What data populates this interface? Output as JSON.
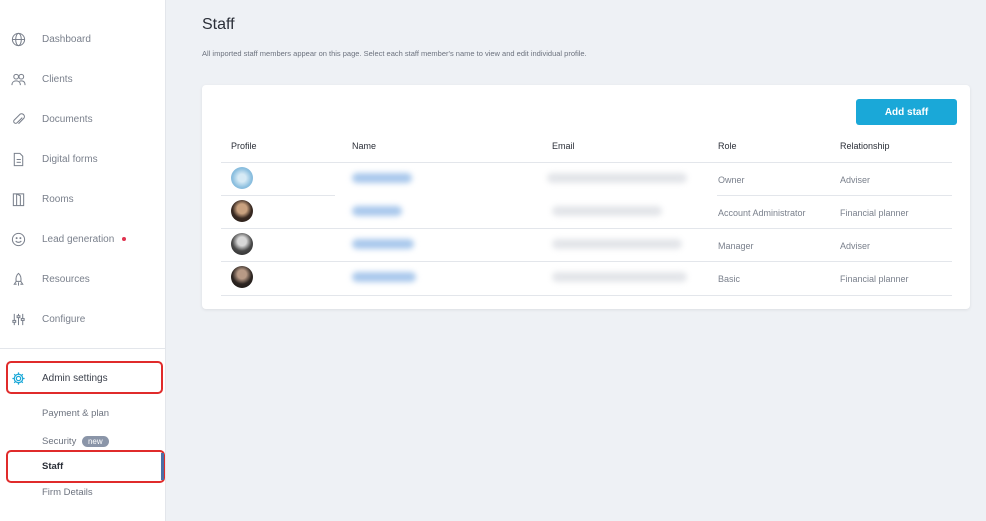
{
  "sidebar": {
    "items": [
      {
        "label": "Dashboard",
        "icon": "globe-icon"
      },
      {
        "label": "Clients",
        "icon": "users-icon"
      },
      {
        "label": "Documents",
        "icon": "paperclip-icon"
      },
      {
        "label": "Digital forms",
        "icon": "form-icon"
      },
      {
        "label": "Rooms",
        "icon": "door-icon"
      },
      {
        "label": "Lead generation",
        "icon": "smiley-icon"
      },
      {
        "label": "Resources",
        "icon": "rocket-icon"
      },
      {
        "label": "Configure",
        "icon": "sliders-icon"
      }
    ],
    "admin": {
      "label": "Admin settings",
      "icon": "gear-icon"
    },
    "sub_items": {
      "payment": "Payment & plan",
      "security": "Security",
      "security_badge": "new",
      "staff": "Staff",
      "firm": "Firm Details"
    }
  },
  "main": {
    "title": "Staff",
    "description": "All imported staff members appear on this page. Select each staff member's name to view and edit individual profile.",
    "add_button": "Add staff",
    "columns": [
      "Profile",
      "Name",
      "Email",
      "Role",
      "Relationship"
    ],
    "rows": [
      {
        "role": "Owner",
        "relationship": "Adviser"
      },
      {
        "role": "Account Administrator",
        "relationship": "Financial planner"
      },
      {
        "role": "Manager",
        "relationship": "Adviser"
      },
      {
        "role": "Basic",
        "relationship": "Financial planner"
      }
    ]
  },
  "colors": {
    "accent": "#1aa8d8",
    "highlight": "#e02b2b",
    "alert_dot": "#e0334f"
  }
}
